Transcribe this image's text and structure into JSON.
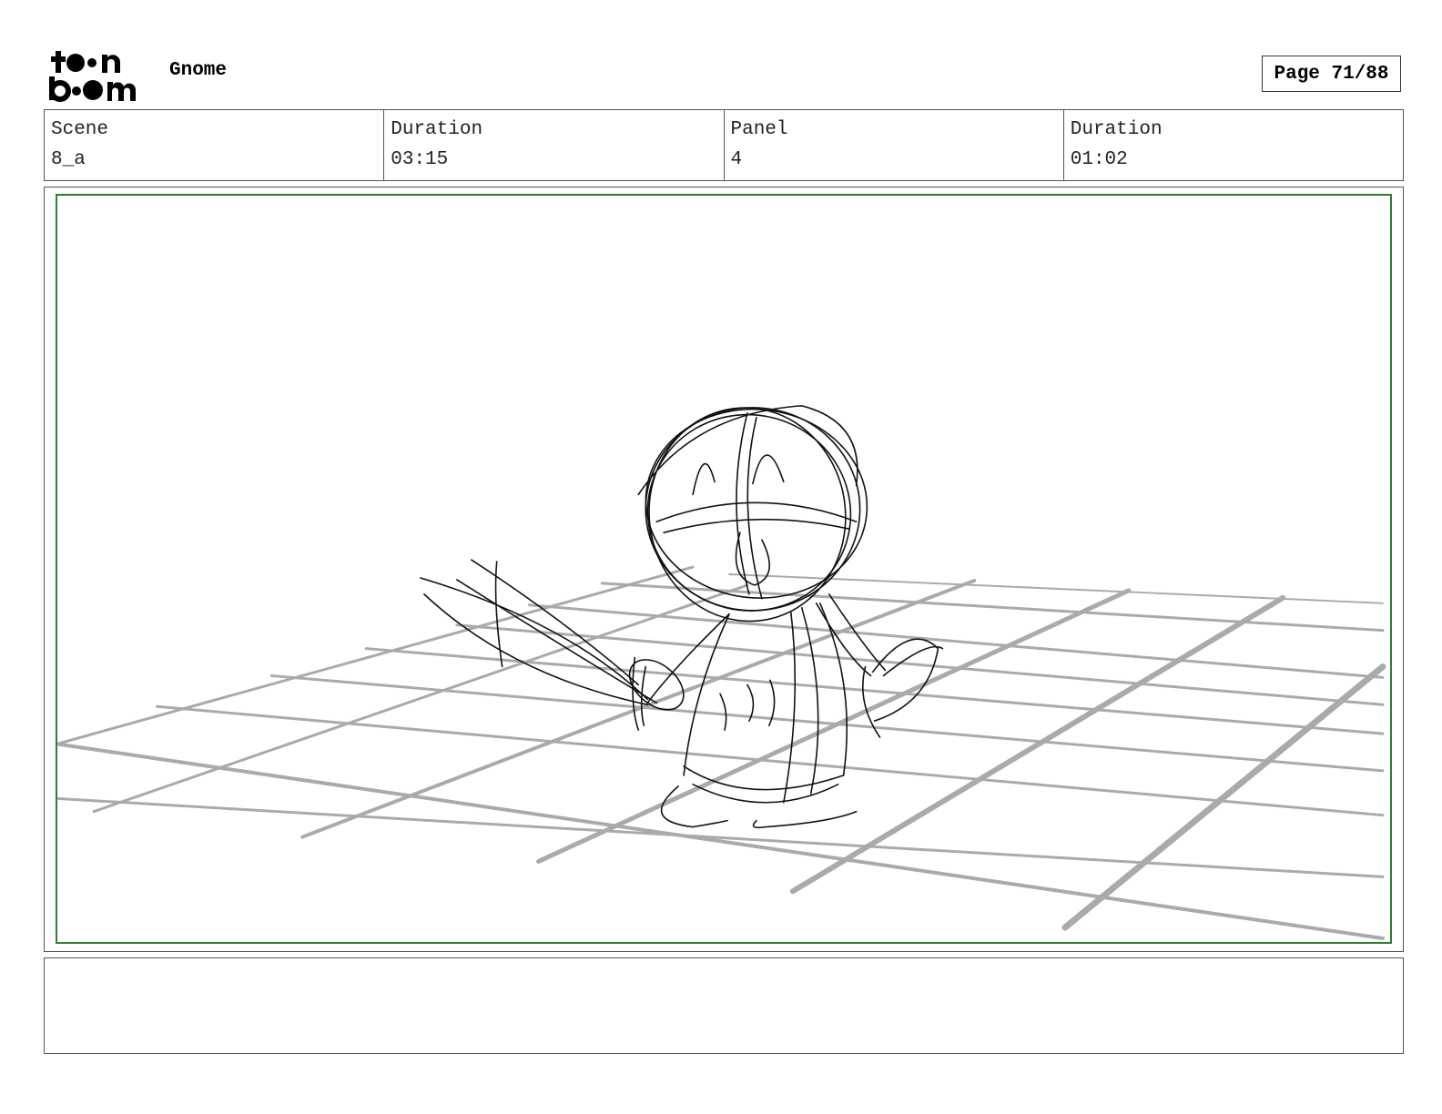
{
  "logo": {
    "text_top": "toon",
    "text_bottom": "boom"
  },
  "header": {
    "project_title": "Gnome",
    "page_label": "Page 71/88"
  },
  "info": {
    "scene_label": "Scene",
    "scene_value": "8_a",
    "scene_duration_label": "Duration",
    "scene_duration_value": "03:15",
    "panel_label": "Panel",
    "panel_value": "4",
    "panel_duration_label": "Duration",
    "panel_duration_value": "01:02"
  },
  "notes": {
    "text": ""
  },
  "colors": {
    "safe_frame": "#2e7d32",
    "grid_lines": "#aaaaaa",
    "sketch_lines": "#111111"
  }
}
